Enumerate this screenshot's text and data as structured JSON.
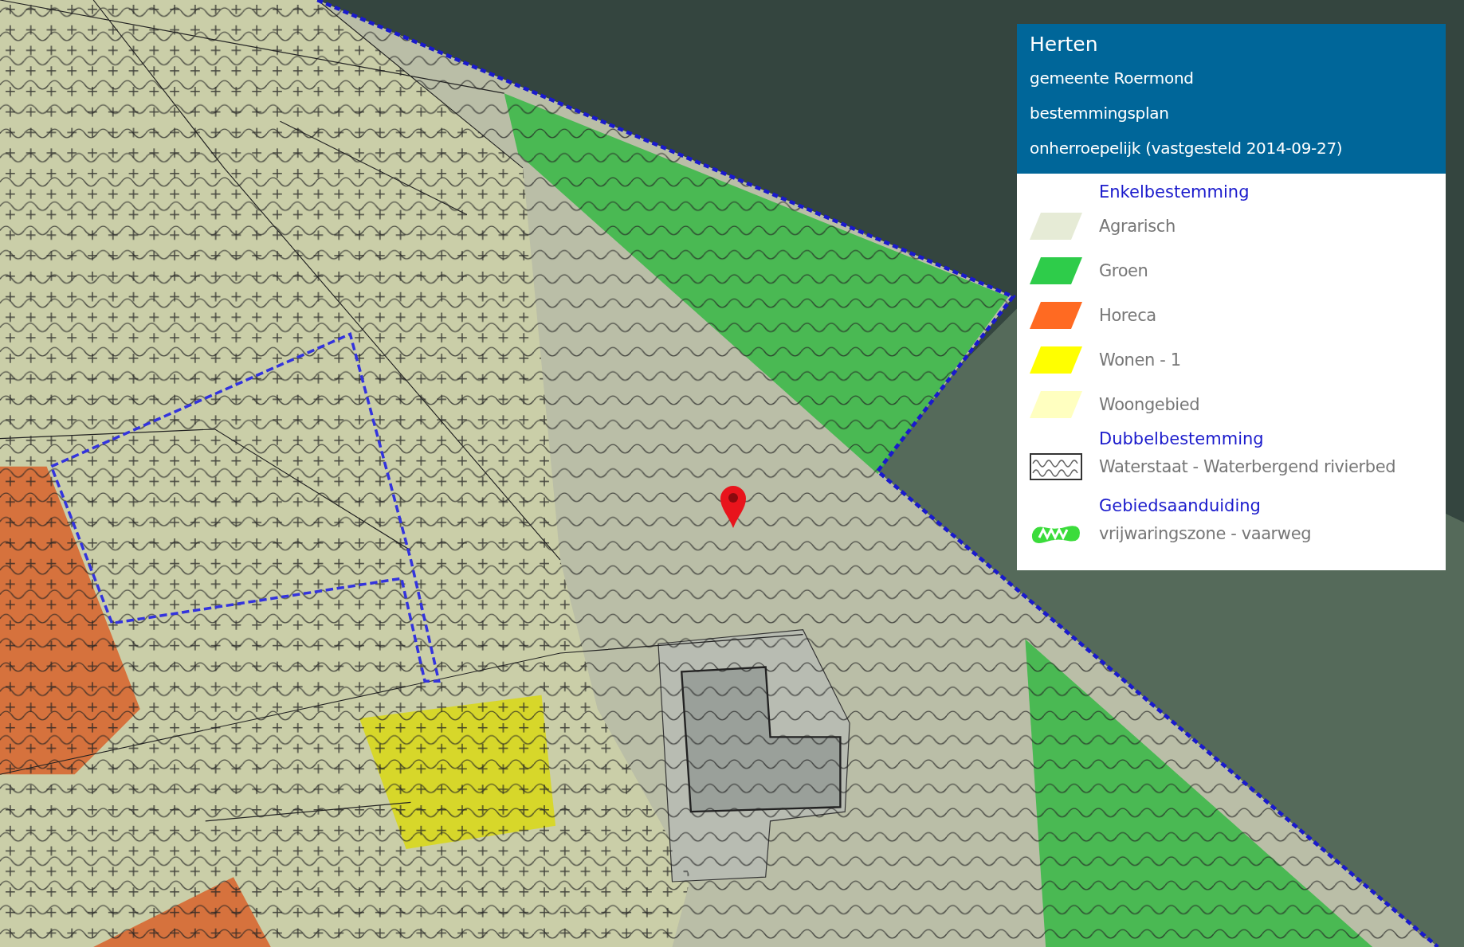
{
  "plan": {
    "place": "Herten",
    "municipality": "gemeente Roermond",
    "plan_type": "bestemmingsplan",
    "status": "onherroepelijk (vastgesteld 2014-09-27)"
  },
  "legend": [
    {
      "heading": "Enkelbestemming",
      "items": [
        {
          "label": "Agrarisch",
          "kind": "swatch",
          "color": "#e6ebd6"
        },
        {
          "label": "Groen",
          "kind": "swatch",
          "color": "#2ecc4a"
        },
        {
          "label": "Horeca",
          "kind": "swatch",
          "color": "#ff6a22"
        },
        {
          "label": "Wonen - 1",
          "kind": "swatch",
          "color": "#ffff00"
        },
        {
          "label": "Woongebied",
          "kind": "swatch",
          "color": "#ffffc0"
        }
      ]
    },
    {
      "heading": "Dubbelbestemming",
      "items": [
        {
          "label": "Waterstaat - Waterbergend rivierbed",
          "kind": "wave-pattern"
        }
      ]
    },
    {
      "heading": "Gebiedsaanduiding",
      "items": [
        {
          "label": "vrijwaringszone - vaarweg",
          "kind": "zone-symbol"
        }
      ]
    }
  ]
}
